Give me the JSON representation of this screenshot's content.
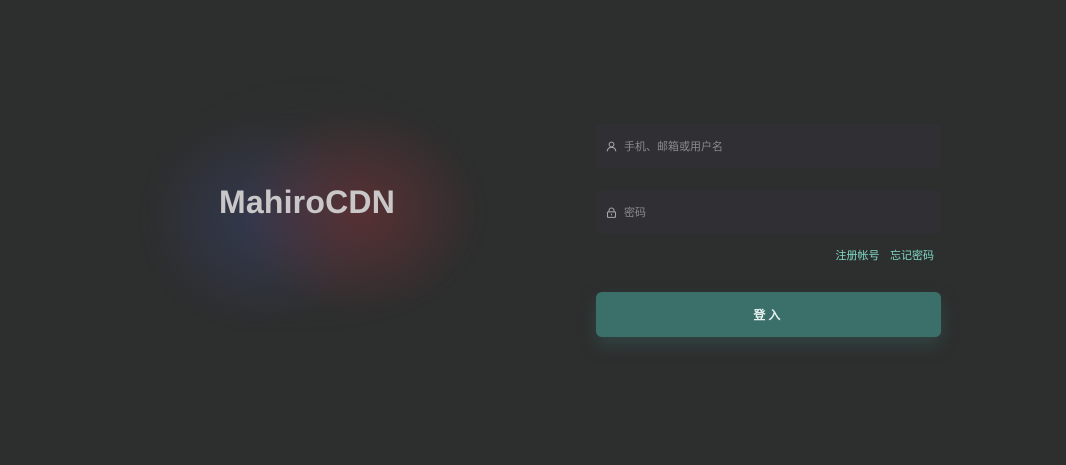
{
  "brand": {
    "title": "MahiroCDN"
  },
  "form": {
    "username": {
      "icon": "user-icon",
      "value": "",
      "placeholder": "手机、邮箱或用户名"
    },
    "password": {
      "icon": "lock-icon",
      "value": "",
      "placeholder": "密码"
    },
    "links": {
      "register": "注册帐号",
      "forgot": "忘记密码"
    },
    "submit_label": "登入"
  },
  "colors": {
    "background": "#2d2e2e",
    "field_bg": "#303034",
    "accent_link": "#7fd8c4",
    "button": "#3a6f6a"
  }
}
